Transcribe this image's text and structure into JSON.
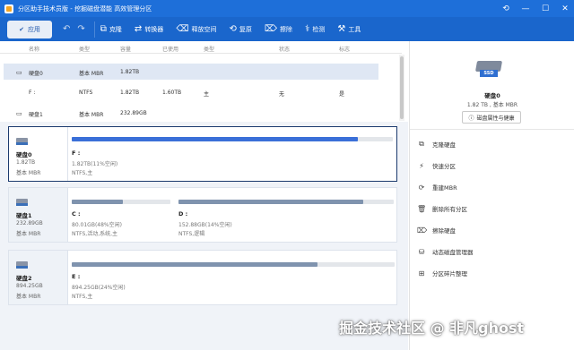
{
  "app": {
    "title": "分区助手技术员版 - 挖掘磁盘潜能 高效管理分区"
  },
  "window_controls": {
    "refresh": "⟲",
    "minimize": "—",
    "maximize": "☐",
    "close": "✕"
  },
  "toolbar": {
    "apply": "应用",
    "buttons": [
      {
        "label": "克隆",
        "icon": "clone-icon",
        "glyph": "⧉"
      },
      {
        "label": "转换器",
        "icon": "convert-icon",
        "glyph": "⇄"
      },
      {
        "label": "释放空间",
        "icon": "free-space-icon",
        "glyph": "⌫"
      },
      {
        "label": "复原",
        "icon": "restore-icon",
        "glyph": "⟲"
      },
      {
        "label": "擦除",
        "icon": "wipe-icon",
        "glyph": "⌦"
      },
      {
        "label": "检测",
        "icon": "check-icon",
        "glyph": "⚕"
      },
      {
        "label": "工具",
        "icon": "tools-icon",
        "glyph": "⚒"
      }
    ]
  },
  "columns": [
    "名称",
    "类型",
    "容量",
    "已使用",
    "类型",
    "状态",
    "标志"
  ],
  "disks": [
    {
      "name": "硬盘0",
      "type": "基本 MBR",
      "capacity": "1.82TB",
      "used": "",
      "ptype": "",
      "status": "",
      "flag": ""
    },
    {
      "name": "F :",
      "type": "NTFS",
      "capacity": "1.82TB",
      "used": "1.60TB",
      "ptype": "主",
      "status": "无",
      "flag": "是"
    },
    {
      "name": "硬盘1",
      "type": "基本 MBR",
      "capacity": "232.89GB",
      "used": "",
      "ptype": "",
      "status": "",
      "flag": ""
    }
  ],
  "map": [
    {
      "name": "硬盘0",
      "size": "1.82TB",
      "type": "基本 MBR",
      "partitions": [
        {
          "name": "F :",
          "info": "1.82TB(11%空闲)",
          "fs": "NTFS,主",
          "used_fraction": 0.89,
          "color": "#3a6fd8"
        }
      ]
    },
    {
      "name": "硬盘1",
      "size": "232.89GB",
      "type": "基本 MBR",
      "partitions": [
        {
          "name": "C :",
          "info": "80.01GB(48%空闲)",
          "fs": "NTFS,活动,系统,主",
          "used_fraction": 0.52,
          "color": "#7f93ae"
        },
        {
          "name": "D :",
          "info": "152.88GB(14%空闲)",
          "fs": "NTFS,逻辑",
          "used_fraction": 0.86,
          "color": "#7f93ae"
        }
      ]
    },
    {
      "name": "硬盘2",
      "size": "894.25GB",
      "type": "基本 MBR",
      "partitions": [
        {
          "name": "E :",
          "info": "894.25GB(24%空闲)",
          "fs": "NTFS,主",
          "used_fraction": 0.76,
          "color": "#7f93ae"
        }
      ]
    }
  ],
  "right_panel": {
    "ssd_label": "SSD",
    "disk_name": "硬盘0",
    "disk_info": "1.82 TB , 基本 MBR",
    "properties_button": "磁盘属性与健康",
    "actions": [
      {
        "label": "克隆硬盘",
        "icon": "clone-disk-icon",
        "glyph": "⧉"
      },
      {
        "label": "快速分区",
        "icon": "quick-partition-icon",
        "glyph": "⚡"
      },
      {
        "label": "重建MBR",
        "icon": "rebuild-mbr-icon",
        "glyph": "⟳"
      },
      {
        "label": "删除所有分区",
        "icon": "delete-partitions-icon",
        "glyph": "🗑"
      },
      {
        "label": "擦除硬盘",
        "icon": "wipe-disk-icon",
        "glyph": "⌦"
      },
      {
        "label": "动态磁盘管理器",
        "icon": "dynamic-disk-icon",
        "glyph": "⛁"
      },
      {
        "label": "分区碎片整理",
        "icon": "defrag-icon",
        "glyph": "⊞"
      }
    ]
  },
  "watermark": "掘金技术社区 @ 非凡ghost"
}
